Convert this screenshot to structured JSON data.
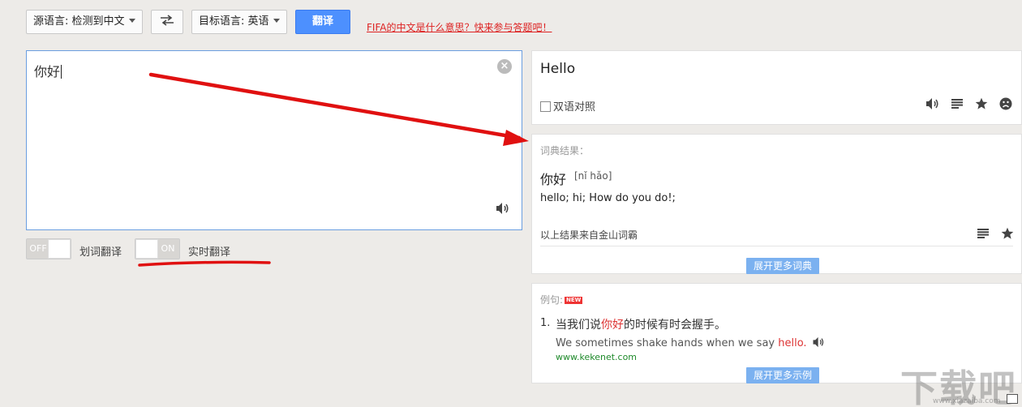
{
  "toolbar": {
    "source_lang": "源语言: 检测到中文",
    "swap_icon": "swap-arrows",
    "target_lang": "目标语言: 英语",
    "translate": "翻译",
    "promo": "FIFA的中文是什么意思？快来参与答题吧！"
  },
  "source": {
    "text": "你好",
    "clear_icon": "close-circle",
    "speak_icon": "speaker"
  },
  "toggles": {
    "word_state": "OFF",
    "word_label": "划词翻译",
    "realtime_state": "ON",
    "realtime_label": "实时翻译"
  },
  "result": {
    "text": "Hello",
    "bilingual_label": "双语对照",
    "icons": [
      "speaker",
      "list",
      "star",
      "sad-face"
    ]
  },
  "dictionary": {
    "heading": "词典结果：",
    "word": "你好",
    "phonetic": "[nǐ hǎo]",
    "definition": "hello; hi; How do you do!;",
    "source_note": "以上结果来自金山词霸",
    "more_button": "展开更多词典"
  },
  "examples": {
    "heading": "例句:",
    "badge": "NEW",
    "items": [
      {
        "num": "1.",
        "cn_pre": "当我们说",
        "cn_hl": "你好",
        "cn_post": "的时候有时会握手。",
        "en_pre": "We sometimes shake hands when we say ",
        "en_hl": "hello.",
        "url": "www.kekenet.com"
      }
    ],
    "more_button": "展开更多示例"
  },
  "watermark": {
    "text": "下载吧",
    "url": "www.xiazaiba.com"
  },
  "colors": {
    "accent": "#4d90fe",
    "annotation": "#e01010",
    "highlight": "#dd3333",
    "link_green": "#1e8a2a"
  }
}
